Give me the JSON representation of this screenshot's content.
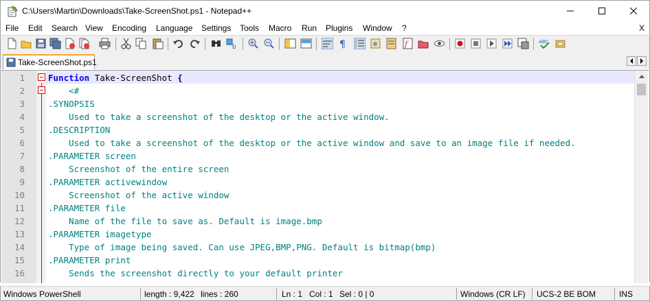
{
  "window": {
    "title": "C:\\Users\\Martin\\Downloads\\Take-ScreenShot.ps1 - Notepad++",
    "app_icon": "notepad-plus-plus-icon"
  },
  "menu": {
    "items": [
      "File",
      "Edit",
      "Search",
      "View",
      "Encoding",
      "Language",
      "Settings",
      "Tools",
      "Macro",
      "Run",
      "Plugins",
      "Window",
      "?"
    ],
    "close_label": "X"
  },
  "toolbar": {
    "icons": [
      "new-file-icon",
      "open-file-icon",
      "save-icon",
      "save-all-icon",
      "close-icon",
      "close-all-icon",
      "print-icon",
      "cut-icon",
      "copy-icon",
      "paste-icon",
      "undo-icon",
      "redo-icon",
      "find-icon",
      "replace-icon",
      "zoom-in-icon",
      "zoom-out-icon",
      "sync-vertical-icon",
      "sync-horizontal-icon",
      "word-wrap-icon",
      "show-all-characters-icon",
      "indent-guide-icon",
      "user-defined-language-icon",
      "document-map-icon",
      "function-list-icon",
      "folder-as-workspace-icon",
      "monitoring-icon",
      "record-macro-icon",
      "stop-recording-icon",
      "playback-macro-icon",
      "run-macro-multiple-icon",
      "save-macro-icon",
      "spell-check-icon",
      "plugin-icon"
    ]
  },
  "tabs": [
    {
      "label": "Take-ScreenShot.ps1",
      "active": true
    }
  ],
  "editor": {
    "lines": [
      {
        "n": "1",
        "parts": [
          {
            "t": "Function",
            "c": "kw"
          },
          {
            "t": " Take-ScreenShot ",
            "c": "plain"
          },
          {
            "t": "{",
            "c": "brace"
          }
        ]
      },
      {
        "n": "2",
        "parts": [
          {
            "t": "    <#",
            "c": "comment"
          }
        ]
      },
      {
        "n": "3",
        "parts": [
          {
            "t": ".SYNOPSIS",
            "c": "comment"
          }
        ]
      },
      {
        "n": "4",
        "parts": [
          {
            "t": "    Used to take a screenshot of the desktop or the active window.",
            "c": "comment"
          }
        ]
      },
      {
        "n": "5",
        "parts": [
          {
            "t": ".DESCRIPTION",
            "c": "comment"
          }
        ]
      },
      {
        "n": "6",
        "parts": [
          {
            "t": "    Used to take a screenshot of the desktop or the active window and save to an image file if needed.",
            "c": "comment"
          }
        ]
      },
      {
        "n": "7",
        "parts": [
          {
            "t": ".PARAMETER screen",
            "c": "comment"
          }
        ]
      },
      {
        "n": "8",
        "parts": [
          {
            "t": "    Screenshot of the entire screen",
            "c": "comment"
          }
        ]
      },
      {
        "n": "9",
        "parts": [
          {
            "t": ".PARAMETER activewindow",
            "c": "comment"
          }
        ]
      },
      {
        "n": "10",
        "parts": [
          {
            "t": "    Screenshot of the active window",
            "c": "comment"
          }
        ]
      },
      {
        "n": "11",
        "parts": [
          {
            "t": ".PARAMETER file",
            "c": "comment"
          }
        ]
      },
      {
        "n": "12",
        "parts": [
          {
            "t": "    Name of the file to save as. Default is image.bmp",
            "c": "comment"
          }
        ]
      },
      {
        "n": "13",
        "parts": [
          {
            "t": ".PARAMETER imagetype",
            "c": "comment"
          }
        ]
      },
      {
        "n": "14",
        "parts": [
          {
            "t": "    Type of image being saved. Can use JPEG,BMP,PNG. Default is bitmap(bmp)",
            "c": "comment"
          }
        ]
      },
      {
        "n": "15",
        "parts": [
          {
            "t": ".PARAMETER print",
            "c": "comment"
          }
        ]
      },
      {
        "n": "16",
        "parts": [
          {
            "t": "    Sends the screenshot directly to your default printer",
            "c": "comment"
          }
        ]
      }
    ]
  },
  "status": {
    "language": "Windows PowerShell",
    "length": "length : 9,422",
    "lines": "lines : 260",
    "ln": "Ln : 1",
    "col": "Col : 1",
    "sel": "Sel : 0 | 0",
    "eol": "Windows (CR LF)",
    "encoding": "UCS-2 BE BOM",
    "mode": "INS"
  },
  "colors": {
    "keyword": "#0000ff",
    "comment": "#008080",
    "fold_marker": "#e00000",
    "current_line": "#e8e8ff",
    "active_tab_accent": "#f8a528"
  }
}
